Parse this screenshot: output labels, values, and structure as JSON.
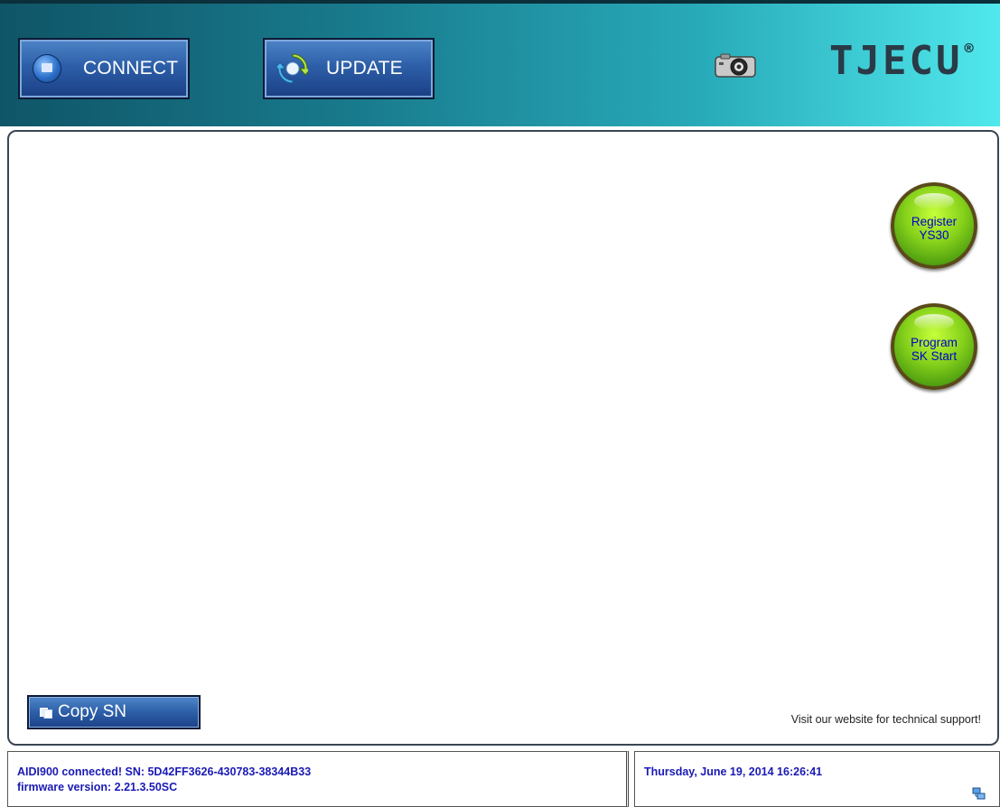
{
  "toolbar": {
    "connect_label": "CONNECT",
    "update_label": "UPDATE",
    "logo_text": "TJECU",
    "logo_reg": "®",
    "icons": [
      "connect-icon",
      "update-icon",
      "camera-icon"
    ]
  },
  "main": {
    "register_label": "Register\nYS30",
    "program_label": "Program\nSK Start",
    "copy_sn_label": "Copy SN",
    "support_text": "Visit our website for technical support!"
  },
  "status": {
    "line1": "AIDI900 connected!  SN: 5D42FF3626-430783-38344B33",
    "line2": "firmware version: 2.21.3.50SC",
    "datetime": "Thursday, June 19, 2014  16:26:41"
  },
  "colors": {
    "toolbar_start": "#0f5567",
    "toolbar_end": "#50e8ec",
    "button_blue": "#2d5fa8",
    "round_green": "#86d11b",
    "status_text": "#1a1ab4"
  }
}
